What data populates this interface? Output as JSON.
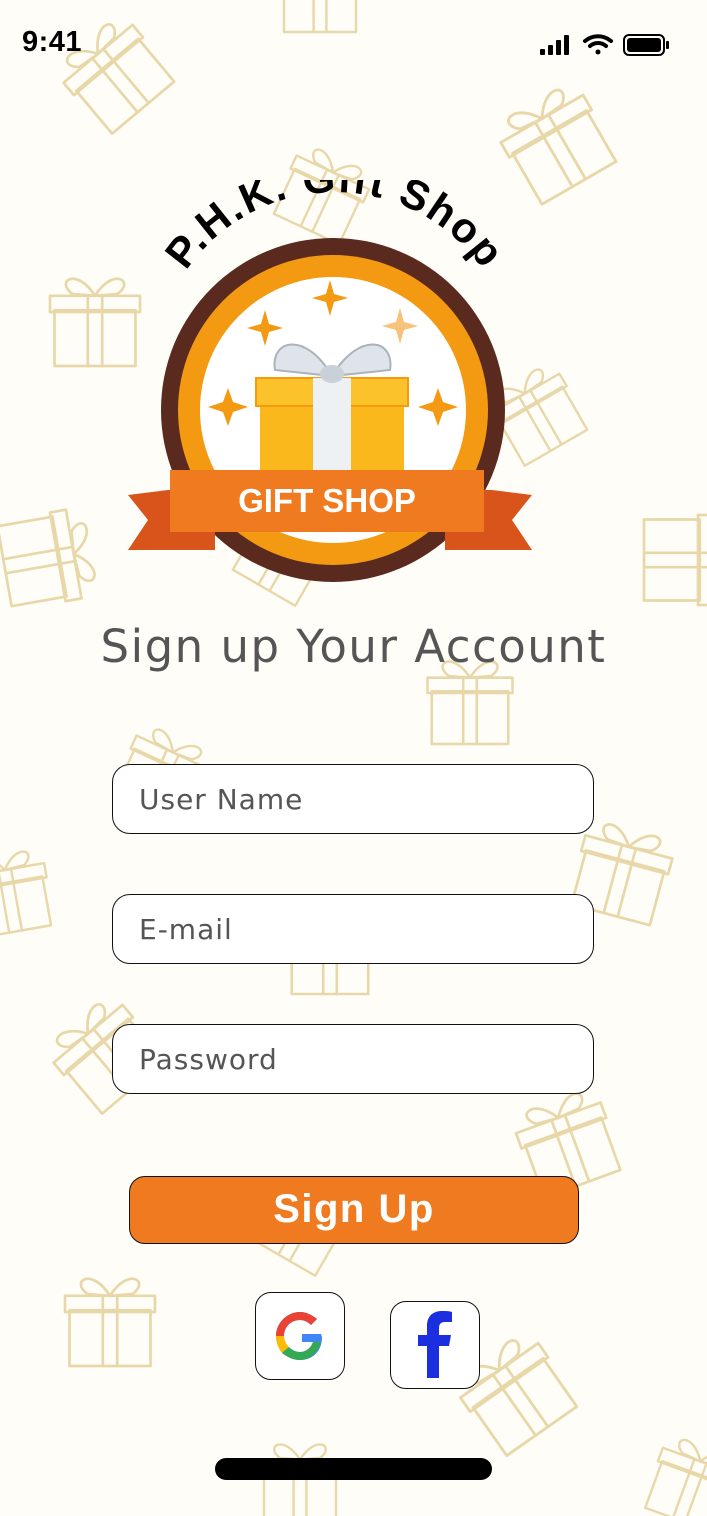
{
  "status_bar": {
    "time": "9:41",
    "icons": [
      "signal-icon",
      "wifi-icon",
      "battery-icon"
    ]
  },
  "logo": {
    "arc_text": "P.H.K. Gift Shop",
    "banner_text": "GIFT SHOP"
  },
  "title": "Sign up Your Account",
  "form": {
    "username_placeholder": "User Name",
    "email_placeholder": "E-mail",
    "password_placeholder": "Password",
    "submit_label": "Sign Up"
  },
  "social": {
    "google": "google-icon",
    "facebook": "facebook-icon"
  },
  "colors": {
    "accent": "#f07a1f",
    "logo_brown": "#5a2a1f",
    "logo_orange": "#f39a12",
    "pattern": "#e8d7a8"
  }
}
